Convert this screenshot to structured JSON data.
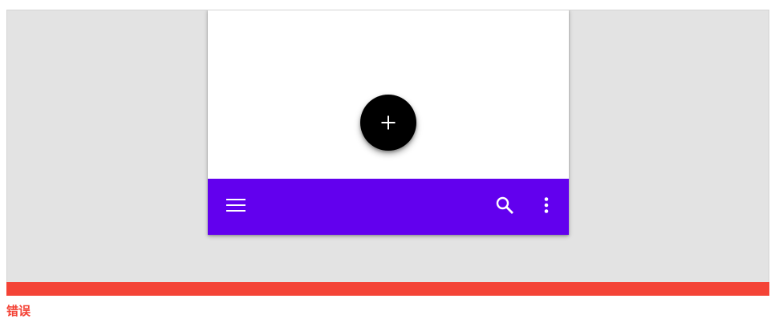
{
  "colors": {
    "app_bar": "#6200ee",
    "fab": "#000000",
    "icon": "#ffffff",
    "error": "#f44336"
  },
  "fab": {
    "icon": "add-icon"
  },
  "bottom_app_bar": {
    "navigation_icon": "menu-icon",
    "actions": [
      "search-icon",
      "more-vert-icon"
    ]
  },
  "status": {
    "label": "错误"
  }
}
